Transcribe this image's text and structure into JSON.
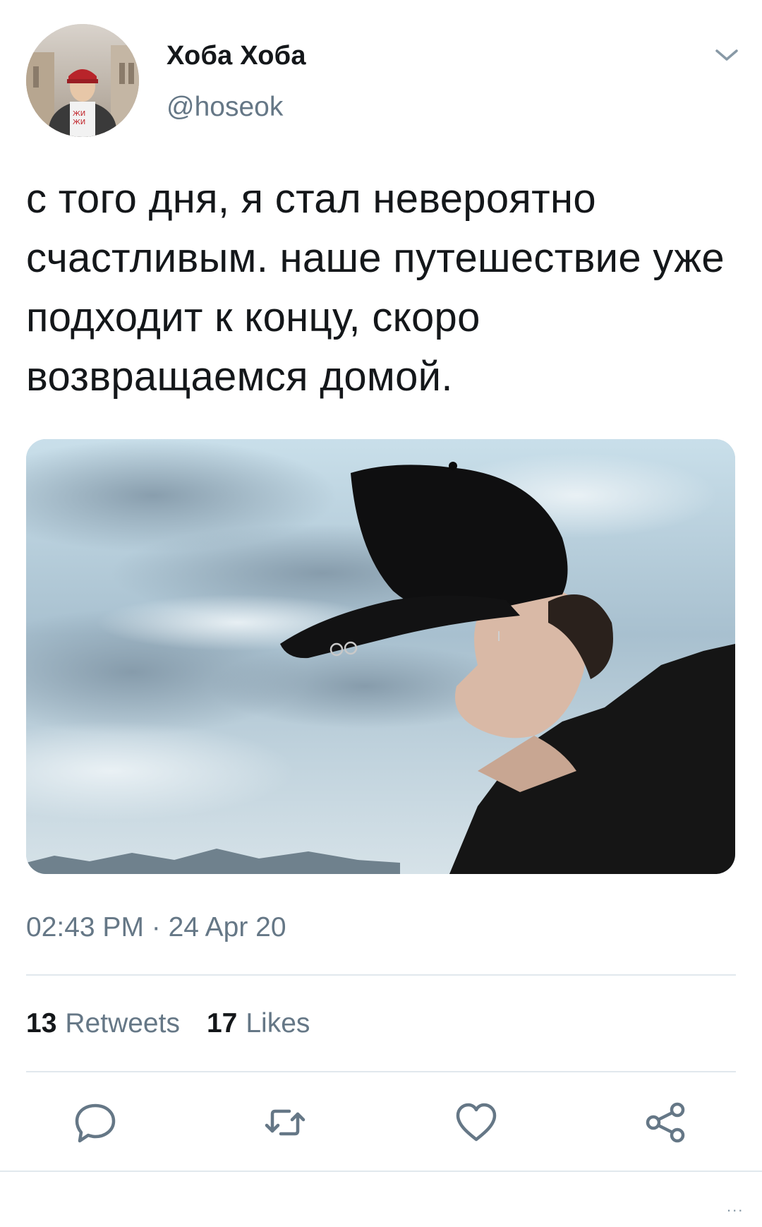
{
  "author": {
    "display_name": "Хоба Хоба",
    "handle": "@hoseok",
    "avatar_icon": "user-avatar-photo"
  },
  "tweet": {
    "text": "с того дня, я стал невероятно счастливым. наше путешествие уже подходит к концу, скоро возвращаемся домой.",
    "timestamp": "02:43 PM · 24 Apr 20",
    "media_description_icon": "photo-media"
  },
  "stats": {
    "retweets_count": "13",
    "retweets_label": "Retweets",
    "likes_count": "17",
    "likes_label": "Likes"
  },
  "actions": {
    "reply_icon": "reply-icon",
    "retweet_icon": "retweet-icon",
    "like_icon": "heart-icon",
    "share_icon": "share-icon"
  },
  "footer": {
    "overflow": "..."
  },
  "colors": {
    "text_primary": "#14171a",
    "text_secondary": "#657786",
    "divider": "#e1e8ed",
    "icon": "#657786"
  }
}
